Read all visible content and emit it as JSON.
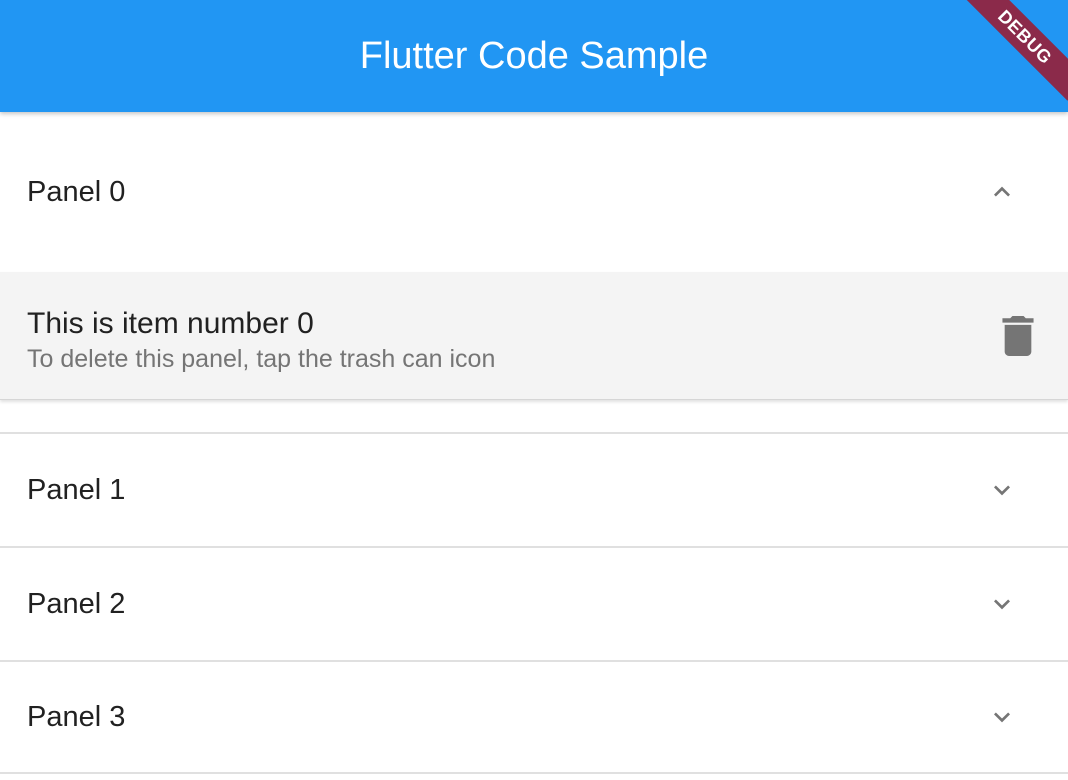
{
  "app": {
    "title": "Flutter Code Sample",
    "debug_label": "DEBUG",
    "primary_color": "#2196f3",
    "debug_color": "#8b2a4a"
  },
  "panels": [
    {
      "header": "Panel 0",
      "expanded": true,
      "chevron": "chevron-up-icon",
      "item_title": "This is item number 0",
      "item_subtitle": "To delete this panel, tap the trash can icon",
      "action_icon": "trash-icon"
    },
    {
      "header": "Panel 1",
      "expanded": false,
      "chevron": "chevron-down-icon"
    },
    {
      "header": "Panel 2",
      "expanded": false,
      "chevron": "chevron-down-icon"
    },
    {
      "header": "Panel 3",
      "expanded": false,
      "chevron": "chevron-down-icon"
    }
  ]
}
